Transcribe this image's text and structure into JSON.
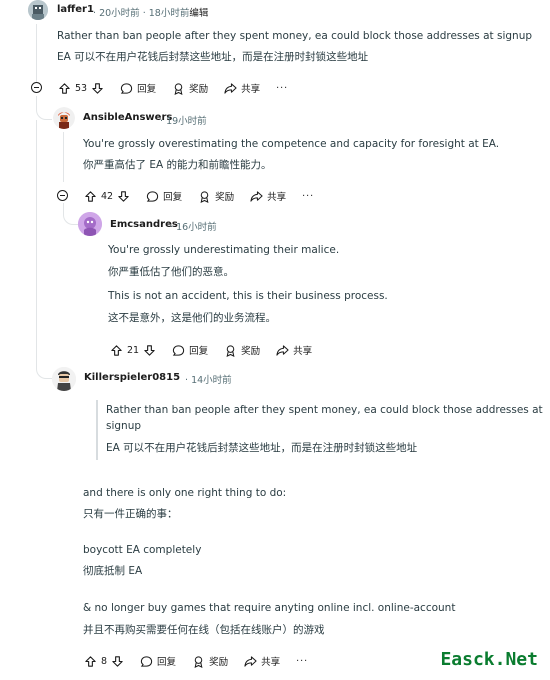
{
  "comments": [
    {
      "username": "laffer1",
      "time": "20小时前",
      "edited_time": "18小时前",
      "edited_label": "编辑",
      "lines": [
        "Rather than ban people after they spent money, ea could block those addresses at signup",
        "EA 可以不在用户花钱后封禁这些地址，而是在注册时封锁这些地址"
      ],
      "votes": "53",
      "reply": "回复",
      "award": "奖励",
      "share": "共享",
      "more": "···"
    },
    {
      "username": "AnsibleAnswers",
      "time": "19小时前",
      "lines": [
        "You're grossly overestimating the competence and capacity for foresight at EA.",
        "你严重高估了 EA 的能力和前瞻性能力。"
      ],
      "votes": "42",
      "reply": "回复",
      "award": "奖励",
      "share": "共享",
      "more": "···"
    },
    {
      "username": "Emcsandres",
      "time": "16小时前",
      "lines": [
        "You're grossly underestimating their malice.",
        "你严重低估了他们的恶意。",
        "This is not an accident, this is their business process.",
        "这不是意外，这是他们的业务流程。"
      ],
      "votes": "21",
      "reply": "回复",
      "award": "奖励",
      "share": "共享"
    },
    {
      "username": "Killerspieler0815",
      "time": "14小时前",
      "quote_lines": [
        "Rather than ban people after they spent money, ea could block those addresses at",
        "signup",
        "EA 可以不在用户花钱后封禁这些地址，而是在注册时封锁这些地址"
      ],
      "lines": [
        "and there is only one right thing to do:",
        "只有一件正确的事：",
        "boycott EA completely",
        "彻底抵制 EA",
        "& no longer buy games that require anyting online incl. online-account",
        "并且不再购买需要任何在线（包括在线账户）的游戏"
      ],
      "votes": "8",
      "reply": "回复",
      "award": "奖励",
      "share": "共享",
      "more": "···"
    }
  ],
  "separator": "·",
  "watermark": "Easck.Net",
  "colors": {
    "meta": "#576f76",
    "thread_line": "#e2e5e7",
    "watermark": "#0a7c2f"
  }
}
